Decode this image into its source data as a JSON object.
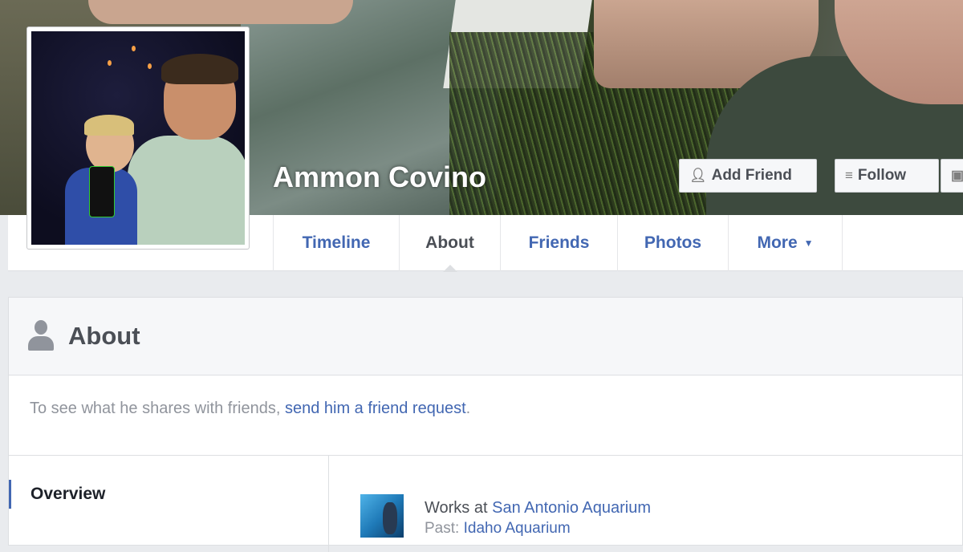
{
  "profile": {
    "name": "Ammon Covino"
  },
  "cover_actions": {
    "add_friend": "Add Friend",
    "follow": "Follow"
  },
  "nav": {
    "tabs": [
      "Timeline",
      "About",
      "Friends",
      "Photos",
      "More"
    ],
    "active": "About"
  },
  "about": {
    "title": "About",
    "notice_prefix": "To see what he shares with friends,",
    "notice_link": "send him a friend request",
    "notice_suffix": ".",
    "sidebar": {
      "overview": "Overview"
    },
    "work": {
      "prefix": "Works at",
      "employer": "San Antonio Aquarium",
      "past_label": "Past:",
      "past_employer": "Idaho Aquarium"
    }
  },
  "colors": {
    "link_blue": "#4267b2",
    "text_dark": "#4b4f56",
    "text_muted": "#90949c",
    "page_bg": "#e9ebee"
  }
}
